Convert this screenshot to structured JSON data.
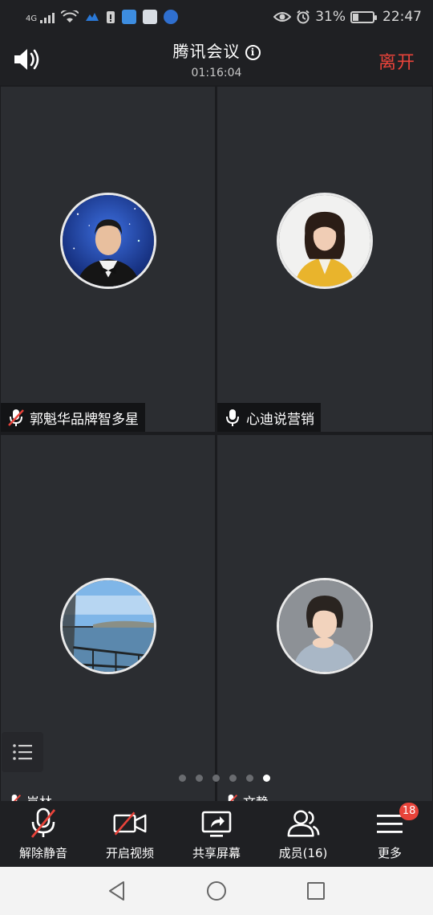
{
  "status_bar": {
    "network": "4G",
    "battery_percent": "31%",
    "battery_level": 0.31,
    "time": "22:47"
  },
  "header": {
    "title": "腾讯会议",
    "timer": "01:16:04",
    "leave_label": "离开"
  },
  "participants": [
    {
      "name": "郭魁华品牌智多星",
      "mic_muted": true
    },
    {
      "name": "心迪说营销",
      "mic_muted": false
    },
    {
      "name": "岚林",
      "mic_muted": true
    },
    {
      "name": "文静",
      "mic_muted": true
    }
  ],
  "pager": {
    "count": 6,
    "active_index": 5
  },
  "toolbar": {
    "unmute_label": "解除静音",
    "video_label": "开启视频",
    "share_label": "共享屏幕",
    "members_label": "成员(16)",
    "more_label": "更多",
    "more_badge": "18"
  },
  "colors": {
    "accent_red": "#e8433a",
    "tile_bg": "#2b2d31",
    "app_bg": "#1f2023"
  }
}
